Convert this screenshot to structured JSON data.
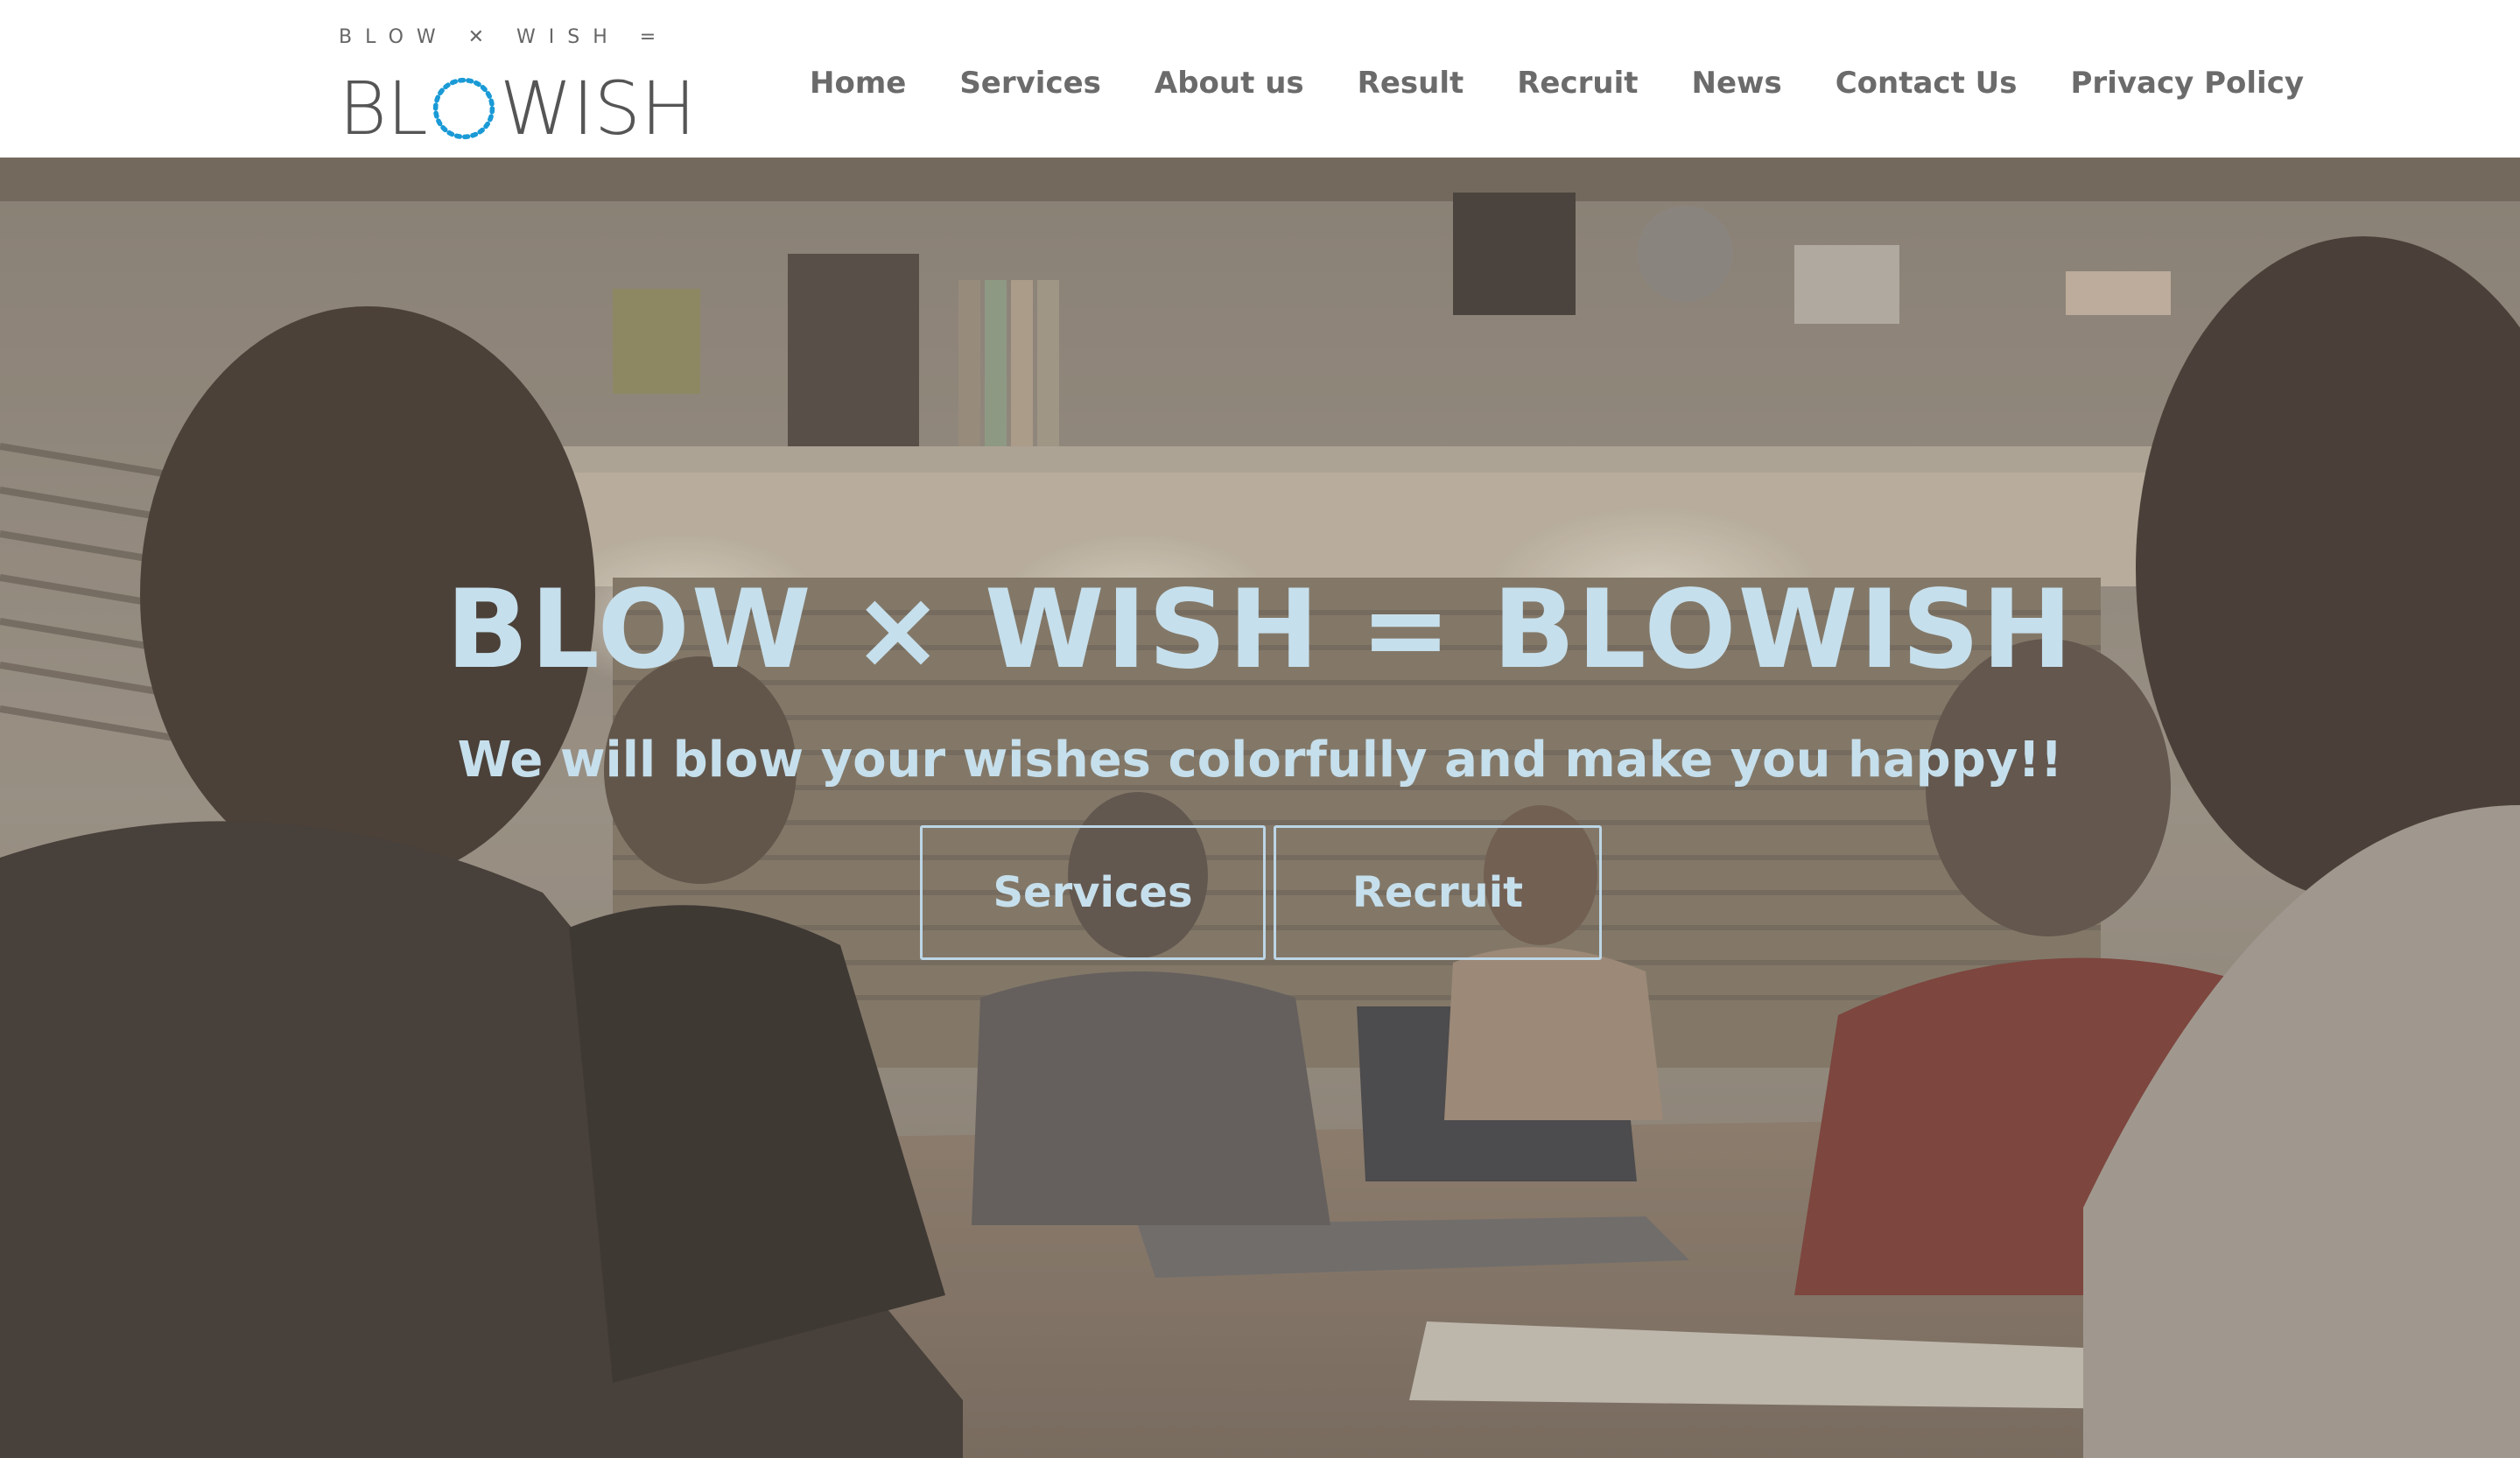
{
  "logo": {
    "tagline": "BLOW ✕ WISH =",
    "name_left": "BL",
    "name_right": "WISH"
  },
  "nav": {
    "items": [
      "Home",
      "Services",
      "About us",
      "Result",
      "Recruit",
      "News",
      "Contact Us",
      "Privacy Policy"
    ]
  },
  "hero": {
    "title": "BLOW × WISH = BLOWISH",
    "subtitle": "We will blow your wishes colorfully and make you happy!!",
    "buttons": {
      "services": "Services",
      "recruit": "Recruit"
    }
  },
  "colors": {
    "accent": "#1a9ad6",
    "hero_text": "#c6dfec",
    "nav_text": "#6b6b6b"
  }
}
